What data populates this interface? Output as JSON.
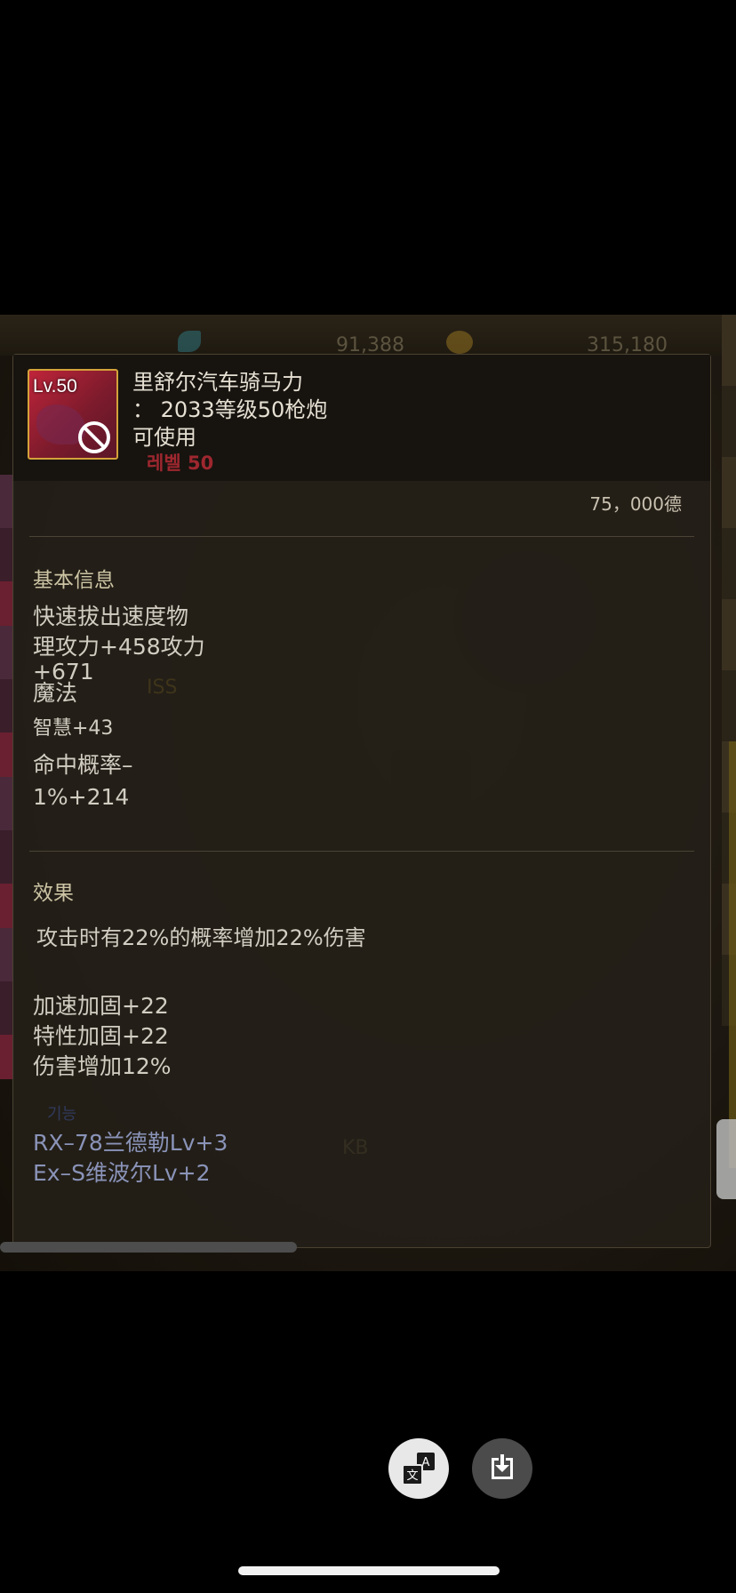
{
  "background": {
    "top_numbers": [
      "91,388",
      "315,180"
    ],
    "faded_overlay_text": "ISS",
    "faded_right_text": "KB"
  },
  "item": {
    "level_badge": "Lv.50",
    "name": "里舒尔汽车骑马力",
    "subtitle": "： 2033等级50枪炮",
    "usable": "可使用",
    "level_requirement": "레벨 50",
    "price": "75，000德"
  },
  "basic_info": {
    "title": "基本信息",
    "line1": "快速拔出速度物",
    "line2": "理攻力+458攻力",
    "line3": "+671",
    "line4": "魔法",
    "line5": "智慧+43",
    "line6": "命中概率–",
    "line7": "1%+214"
  },
  "effect": {
    "title": "效果",
    "description": "攻击时有22%的概率增加22%伤害",
    "bonus1": "加速加固+22",
    "bonus2": "特性加固+22",
    "bonus3": "伤害增加12%"
  },
  "set": {
    "label": "기능",
    "line1": "RX–78兰德勒Lv+3",
    "line2": "Ex–S维波尔Lv+2"
  },
  "colors": {
    "accent_gold": "#d4a23a",
    "icon_red": "#c0243a",
    "set_text": "#8a93b8"
  },
  "icons": {
    "translate": "translate-icon",
    "download": "download-icon",
    "no_use": "prohibited-icon"
  }
}
